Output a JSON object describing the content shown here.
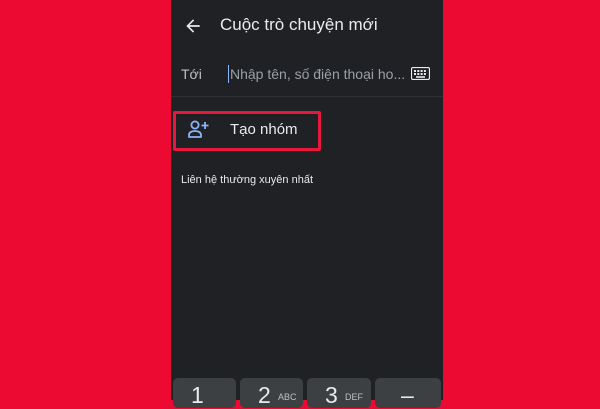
{
  "header": {
    "title": "Cuộc trò chuyện mới"
  },
  "to_field": {
    "label": "Tới",
    "placeholder": "Nhập tên, số điện thoại ho..."
  },
  "create_group": {
    "label": "Tạo nhóm"
  },
  "frequent_section": {
    "label": "Liên hệ thường xuyên nhất"
  },
  "keypad": {
    "keys": [
      {
        "number": "1",
        "letters": ""
      },
      {
        "number": "2",
        "letters": "ABC"
      },
      {
        "number": "3",
        "letters": "DEF"
      },
      {
        "number": "–",
        "letters": ""
      }
    ]
  },
  "colors": {
    "background": "#ec0a32",
    "screen": "#202124",
    "highlight_box": "#e8173e",
    "accent": "#8ab4f8"
  },
  "icons": {
    "back": "arrow-left-icon",
    "keyboard": "keyboard-icon",
    "create_group": "person-add-icon"
  }
}
